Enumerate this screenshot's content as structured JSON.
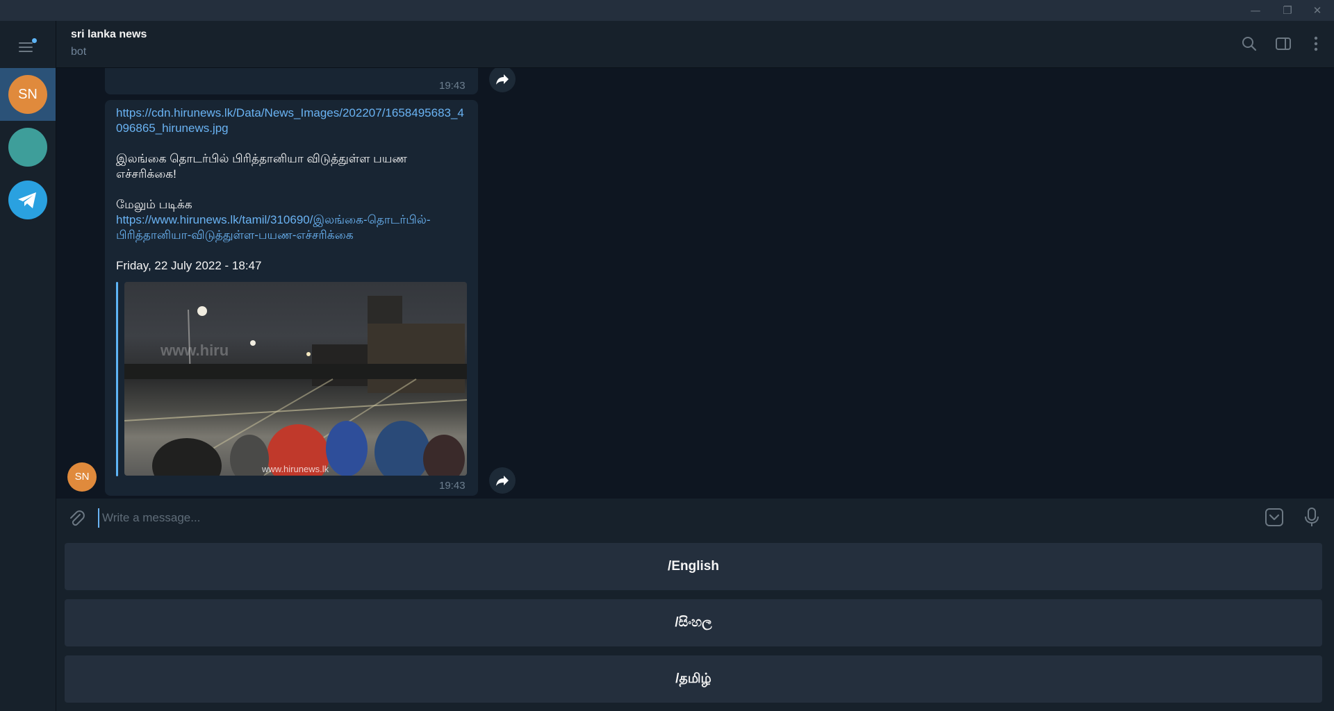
{
  "window": {
    "minimize_glyph": "—",
    "restore_glyph": "❐",
    "close_glyph": "✕"
  },
  "sidebar": {
    "chats": [
      {
        "initials": "SN",
        "color": "#e08a3c",
        "active": true
      },
      {
        "initials": "",
        "color": "#3e9e9a",
        "active": false
      },
      {
        "initials": "",
        "color": "#2aa1e0",
        "icon": "telegram-icon",
        "active": false
      }
    ]
  },
  "header": {
    "title": "sri lanka news",
    "subtitle": "bot"
  },
  "messages": [
    {
      "time": "19:43"
    },
    {
      "link_url": "https://cdn.hirunews.lk/Data/News_Images/202207/1658495683_4096865_hirunews.jpg",
      "headline": "இலங்கை தொடர்பில் பிரித்தானியா விடுத்துள்ள பயண எச்சரிக்கை!",
      "read_more": "மேலும் படிக்க",
      "article_url": "https://www.hirunews.lk/tamil/310690/இலங்கை-தொடர்பில்-பிரித்தானியா-விடுத்துள்ள-பயண-எச்சரிக்கை",
      "date": "Friday, 22 July 2022 - 18:47",
      "photo_watermark_top": "www.hiru",
      "photo_watermark_bottom": "www.hirunews.lk",
      "time": "19:43",
      "sender_initials": "SN"
    }
  ],
  "composer": {
    "placeholder": "Write a message..."
  },
  "keyboard": {
    "buttons": [
      "/English",
      "/සිංහල",
      "/தமிழ்"
    ]
  },
  "colors": {
    "background": "#0e1621",
    "panel": "#17212b",
    "bubble": "#182533",
    "accent": "#5eb5f7",
    "link": "#6ab3f3"
  }
}
